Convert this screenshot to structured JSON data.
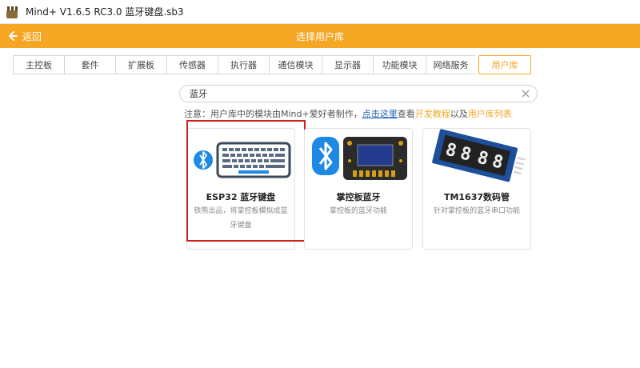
{
  "window": {
    "title": "Mind+ V1.6.5 RC3.0   蓝牙键盘.sb3"
  },
  "header": {
    "back_label": "返回",
    "title": "选择用户库"
  },
  "tabs": [
    {
      "label": "主控板"
    },
    {
      "label": "套件"
    },
    {
      "label": "扩展板"
    },
    {
      "label": "传感器"
    },
    {
      "label": "执行器"
    },
    {
      "label": "通信模块"
    },
    {
      "label": "显示器"
    },
    {
      "label": "功能模块"
    },
    {
      "label": "网络服务"
    },
    {
      "label": "用户库",
      "active": true
    }
  ],
  "search": {
    "value": "蓝牙"
  },
  "notice": {
    "prefix": "注意：用户库中的模块由Mind+爱好者制作，",
    "link1": "点击这里",
    "mid": "查看",
    "link2": "开发教程",
    "mid2": "以及",
    "link3": "用户库列表"
  },
  "cards": [
    {
      "name": "ESP32 蓝牙键盘",
      "desc": "铁熊出品，将掌控板模拟成蓝牙键盘",
      "icon": "keyboard-bluetooth-icon"
    },
    {
      "name": "掌控板蓝牙",
      "desc": "掌控板的蓝牙功能",
      "icon": "board-bluetooth-icon"
    },
    {
      "name": "TM1637数码管",
      "desc": "针对掌控板的蓝牙串口功能",
      "icon": "seven-segment-display-icon"
    }
  ],
  "colors": {
    "accent": "#f5a623",
    "highlight": "#cc2222",
    "link": "#1a5fb4",
    "bluetooth": "#1e88e5"
  }
}
